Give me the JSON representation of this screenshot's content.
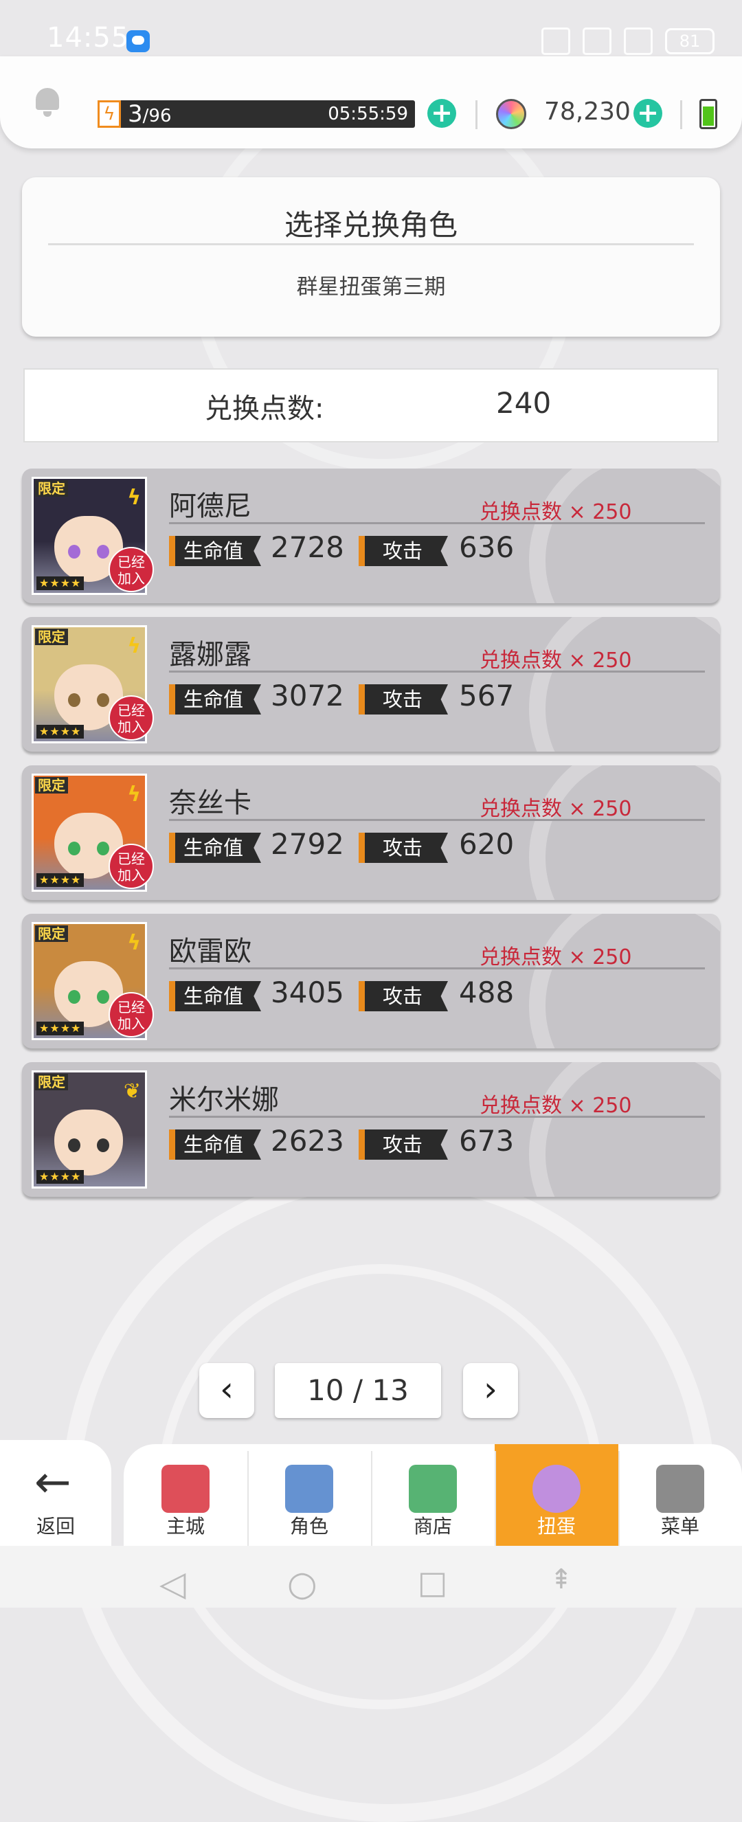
{
  "status_bar": {
    "time": "14:55",
    "battery": "81"
  },
  "resource_bar": {
    "stamina_current": "3",
    "stamina_sep": "/",
    "stamina_max": "96",
    "stamina_fraction": 0.03,
    "stamina_timer": "05:55:59",
    "gem_count": "78,230",
    "accent_color": "#25c5a1"
  },
  "header": {
    "title": "选择兑换角色",
    "subtitle": "群星扭蛋第三期"
  },
  "points": {
    "label": "兑换点数:",
    "value": "240"
  },
  "labels": {
    "hp": "生命值",
    "atk": "攻击",
    "limited": "限定",
    "joined_line1": "已经",
    "joined_line2": "加入",
    "stars": "★★★★"
  },
  "characters": [
    {
      "name": "阿德尼",
      "cost": "兑换点数 × 250",
      "hp": "2728",
      "atk": "636",
      "joined": true,
      "element": "lightning",
      "hair_color": "#2e2a3e",
      "eye_color": "#a46bd6"
    },
    {
      "name": "露娜露",
      "cost": "兑换点数 × 250",
      "hp": "3072",
      "atk": "567",
      "joined": true,
      "element": "lightning",
      "hair_color": "#d9c283",
      "eye_color": "#8a6a3a"
    },
    {
      "name": "奈丝卡",
      "cost": "兑换点数 × 250",
      "hp": "2792",
      "atk": "620",
      "joined": true,
      "element": "lightning",
      "hair_color": "#e4702c",
      "eye_color": "#3fae5a"
    },
    {
      "name": "欧雷欧",
      "cost": "兑换点数 × 250",
      "hp": "3405",
      "atk": "488",
      "joined": true,
      "element": "lightning",
      "hair_color": "#c98a3f",
      "eye_color": "#3fae5a"
    },
    {
      "name": "米尔米娜",
      "cost": "兑换点数 × 250",
      "hp": "2623",
      "atk": "673",
      "joined": false,
      "element": "wind",
      "hair_color": "#4b4450",
      "eye_color": "#333333"
    }
  ],
  "pager": {
    "current_total": "10 / 13"
  },
  "bottom_nav": {
    "back": "返回",
    "items": [
      {
        "label": "主城",
        "icon": "castle-icon",
        "active": false
      },
      {
        "label": "角色",
        "icon": "character-icon",
        "active": false
      },
      {
        "label": "商店",
        "icon": "shop-icon",
        "active": false
      },
      {
        "label": "扭蛋",
        "icon": "gacha-icon",
        "active": true
      },
      {
        "label": "菜单",
        "icon": "menu-icon",
        "active": false
      }
    ]
  }
}
